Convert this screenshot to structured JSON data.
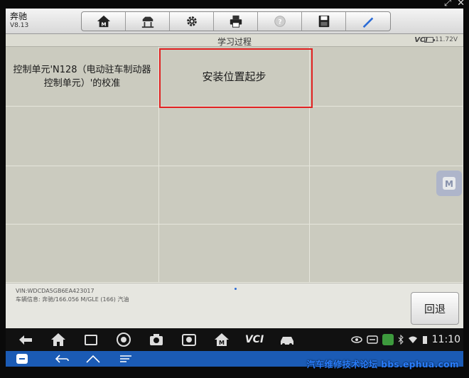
{
  "header": {
    "brand": "奔驰",
    "version": "V8.13"
  },
  "toolbar": {
    "buttons": [
      {
        "icon": "home-icon"
      },
      {
        "icon": "car-lift-icon"
      },
      {
        "icon": "gear-icon"
      },
      {
        "icon": "printer-icon"
      },
      {
        "icon": "help-icon"
      },
      {
        "icon": "save-icon"
      },
      {
        "icon": "pen-icon"
      }
    ]
  },
  "subhead": {
    "title": "学习过程",
    "vci": "VCI",
    "battery": "11.72V"
  },
  "grid": {
    "label": "控制单元'N128（电动驻车制动器控制单元）'的校准",
    "step": "安装位置起步"
  },
  "footer": {
    "vin": "VIN:WDCDA5GB6EA423017",
    "vehicle_info": "车辆信息: 奔驰/166.056 M/GLE (166) 汽油",
    "back_label": "回退"
  },
  "statusbar": {
    "vci": "VCI",
    "time": "11:10"
  },
  "watermark": "汽车维修技术论坛 bbs.ephua.com",
  "colors": {
    "highlight": "#e02020",
    "grid_bg": "#cbcbbf",
    "remote_bar": "#1b5bb5"
  }
}
